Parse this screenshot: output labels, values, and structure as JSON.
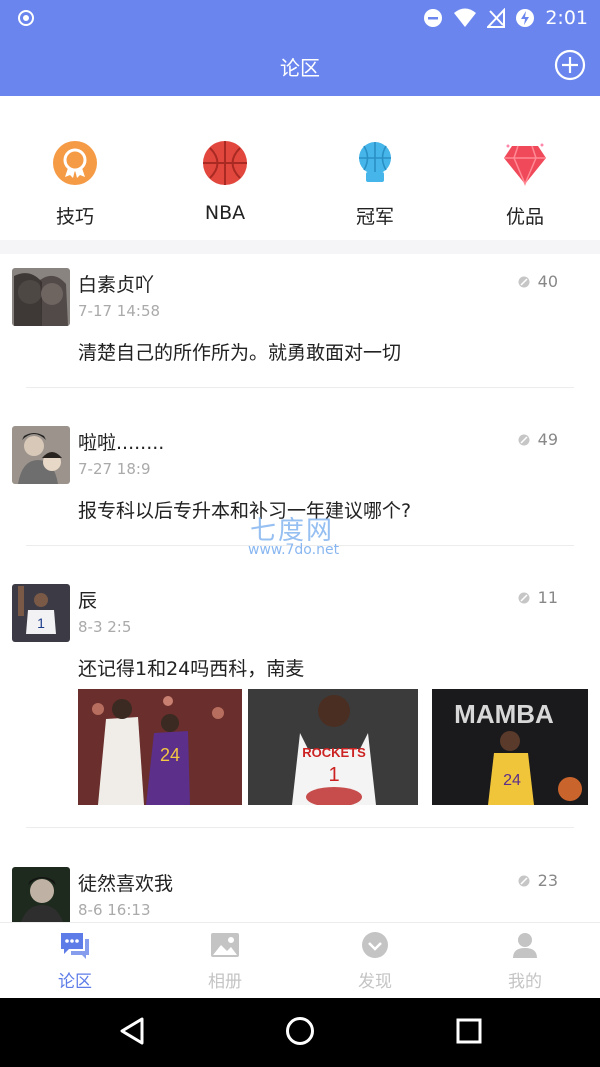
{
  "status_bar": {
    "time": "2:01"
  },
  "app_bar": {
    "title": "论区"
  },
  "categories": [
    {
      "label": "技巧",
      "icon": "medal-icon"
    },
    {
      "label": "NBA",
      "icon": "basketball-icon"
    },
    {
      "label": "冠军",
      "icon": "trophy-icon"
    },
    {
      "label": "优品",
      "icon": "diamond-icon"
    }
  ],
  "posts": [
    {
      "user": "白素贞吖",
      "time": "7-17 14:58",
      "count": "40",
      "text": "清楚自己的所作所为。就勇敢面对一切"
    },
    {
      "user": "啦啦........",
      "time": "7-27 18:9",
      "count": "49",
      "text": "报专科以后专升本和补习一年建议哪个?"
    },
    {
      "user": "辰",
      "time": "8-3 2:5",
      "count": "11",
      "text": "还记得1和24吗西科，南麦",
      "images": [
        "MAMBA"
      ]
    },
    {
      "user": "徒然喜欢我",
      "time": "8-6 16:13",
      "count": "23",
      "text": ""
    }
  ],
  "image_texts": {
    "rockets": "ROCKETS",
    "mamba": "MAMBA",
    "jersey_24": "24",
    "jersey_1": "1"
  },
  "watermark": {
    "line1": "七度网",
    "line2": "www.7do.net"
  },
  "tabs": [
    {
      "label": "论区",
      "active": true
    },
    {
      "label": "相册",
      "active": false
    },
    {
      "label": "发现",
      "active": false
    },
    {
      "label": "我的",
      "active": false
    }
  ],
  "colors": {
    "primary": "#6a86ee",
    "active_tab": "#5d7ce8",
    "inactive_tab": "#c4c4c4"
  }
}
